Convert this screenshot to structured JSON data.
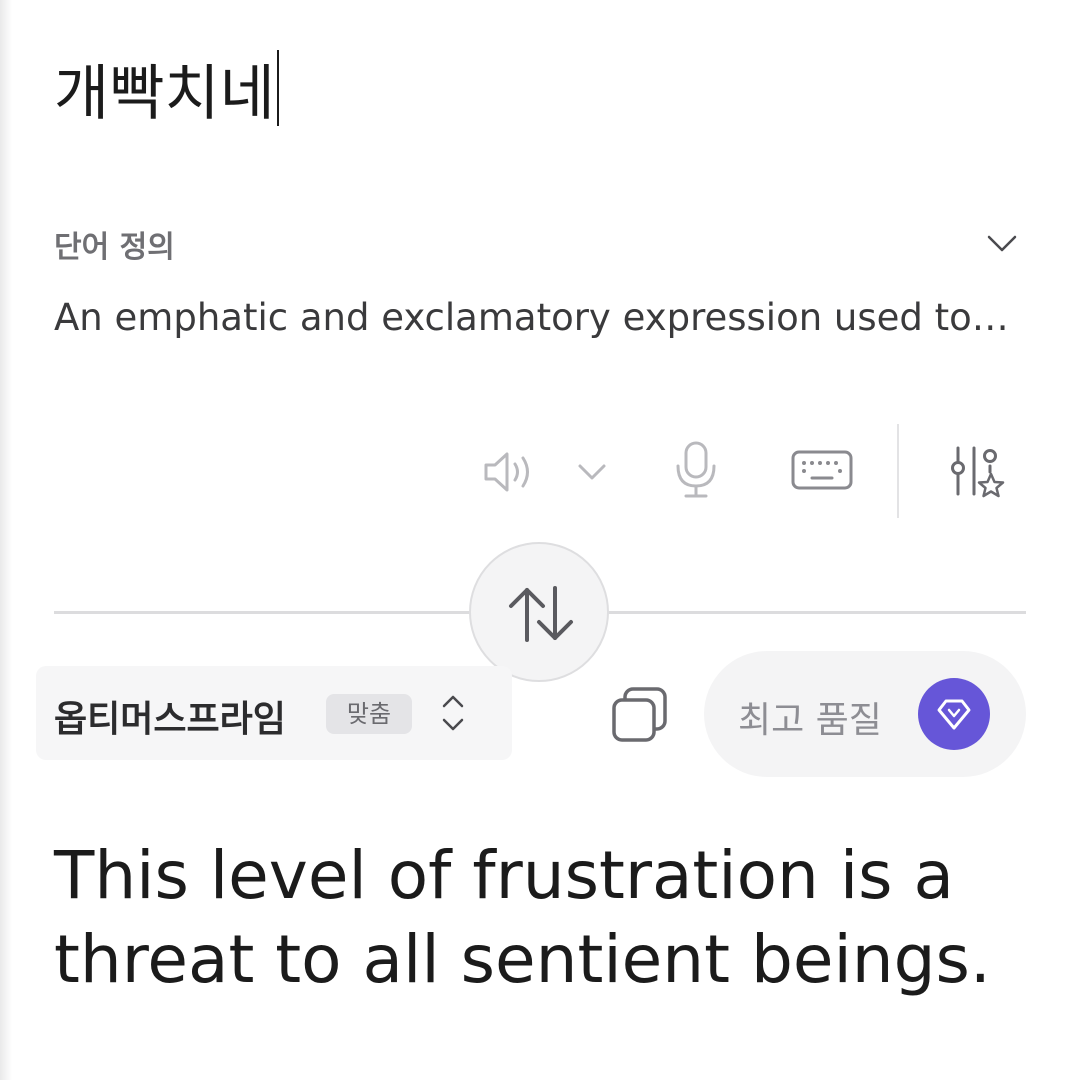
{
  "source": {
    "text": "개빡치네"
  },
  "definition": {
    "title": "단어 정의",
    "text": "An emphatic and exclamatory expression used to…",
    "expand_icon": "chevron-down-icon"
  },
  "toolbar": {
    "icons": [
      "speaker-icon",
      "chevron-down-icon",
      "microphone-icon",
      "keyboard-icon",
      "settings-sliders-star-icon"
    ]
  },
  "swap": {
    "icon": "swap-arrows-icon"
  },
  "model": {
    "name": "옵티머스프라임",
    "badge": "맞춤",
    "icon": "chevron-up-down-icon"
  },
  "copy": {
    "icon": "copy-icon"
  },
  "quality": {
    "label": "최고 품질",
    "icon": "diamond-icon",
    "accent_color": "#6656d8"
  },
  "result": {
    "text": "This level of frustration is a threat to all sentient beings."
  }
}
